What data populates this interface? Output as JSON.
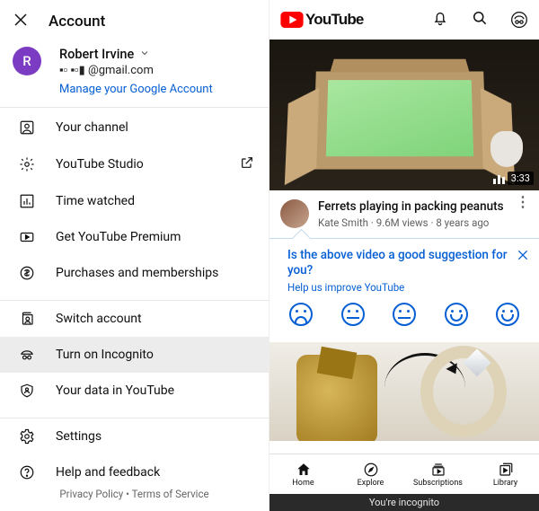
{
  "left": {
    "title": "Account",
    "profile": {
      "initial": "R",
      "name": "Robert Irvine",
      "email": "▪▫ ▪▫▮ @gmail.com",
      "manage": "Manage your Google Account"
    },
    "menu": {
      "channel": "Your channel",
      "studio": "YouTube Studio",
      "time": "Time watched",
      "premium": "Get YouTube Premium",
      "purchases": "Purchases and memberships",
      "switch": "Switch account",
      "incognito": "Turn on Incognito",
      "data": "Your data in YouTube",
      "settings": "Settings",
      "help": "Help and feedback"
    },
    "footer": "Privacy Policy  •  Terms of Service"
  },
  "right": {
    "logo": "YouTube",
    "video1": {
      "duration": "3:33",
      "title": "Ferrets playing in packing peanuts",
      "channel": "Kate Smith",
      "views": "9.6M views",
      "age": "8 years ago"
    },
    "feedback": {
      "question": "Is the above video a good suggestion for you?",
      "help": "Help us improve YouTube"
    },
    "nav": {
      "home": "Home",
      "explore": "Explore",
      "subs": "Subscriptions",
      "library": "Library"
    },
    "inco": "You're incognito"
  }
}
